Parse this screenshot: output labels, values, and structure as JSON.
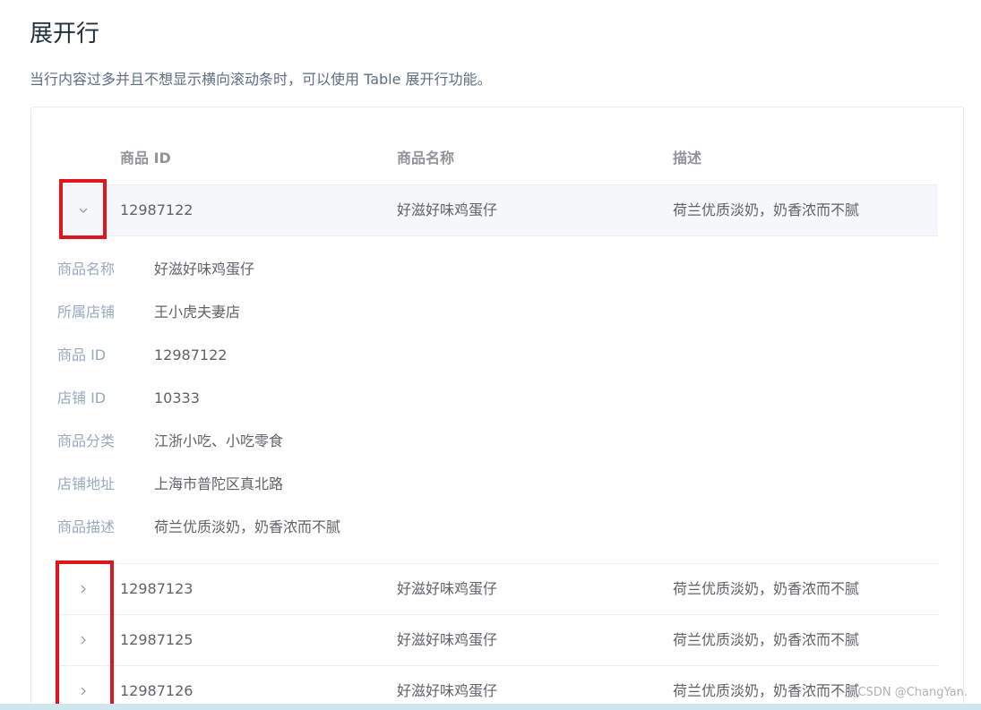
{
  "page": {
    "title": "展开行",
    "description": "当行内容过多并且不想显示横向滚动条时，可以使用 Table 展开行功能。"
  },
  "table": {
    "columns": [
      "商品 ID",
      "商品名称",
      "描述"
    ],
    "rows": [
      {
        "id": "12987122",
        "name": "好滋好味鸡蛋仔",
        "desc": "荷兰优质淡奶，奶香浓而不腻",
        "expanded": true
      },
      {
        "id": "12987123",
        "name": "好滋好味鸡蛋仔",
        "desc": "荷兰优质淡奶，奶香浓而不腻",
        "expanded": false
      },
      {
        "id": "12987125",
        "name": "好滋好味鸡蛋仔",
        "desc": "荷兰优质淡奶，奶香浓而不腻",
        "expanded": false
      },
      {
        "id": "12987126",
        "name": "好滋好味鸡蛋仔",
        "desc": "荷兰优质淡奶，奶香浓而不腻",
        "expanded": false
      }
    ],
    "expanded_detail": [
      {
        "label": "商品名称",
        "value": "好滋好味鸡蛋仔"
      },
      {
        "label": "所属店铺",
        "value": "王小虎夫妻店"
      },
      {
        "label": "商品 ID",
        "value": "12987122"
      },
      {
        "label": "店铺 ID",
        "value": "10333"
      },
      {
        "label": "商品分类",
        "value": "江浙小吃、小吃零食"
      },
      {
        "label": "店铺地址",
        "value": "上海市普陀区真北路"
      },
      {
        "label": "商品描述",
        "value": "荷兰优质淡奶，奶香浓而不腻"
      }
    ]
  },
  "icons": {
    "expanded": "chevron-down-icon",
    "collapsed": "chevron-right-icon"
  },
  "watermark": "CSDN @ChangYan.",
  "colors": {
    "highlight": "#e0161f",
    "label": "#99a9bf",
    "header": "#909399",
    "text": "#606266",
    "hover_row": "#f5f7fa"
  }
}
